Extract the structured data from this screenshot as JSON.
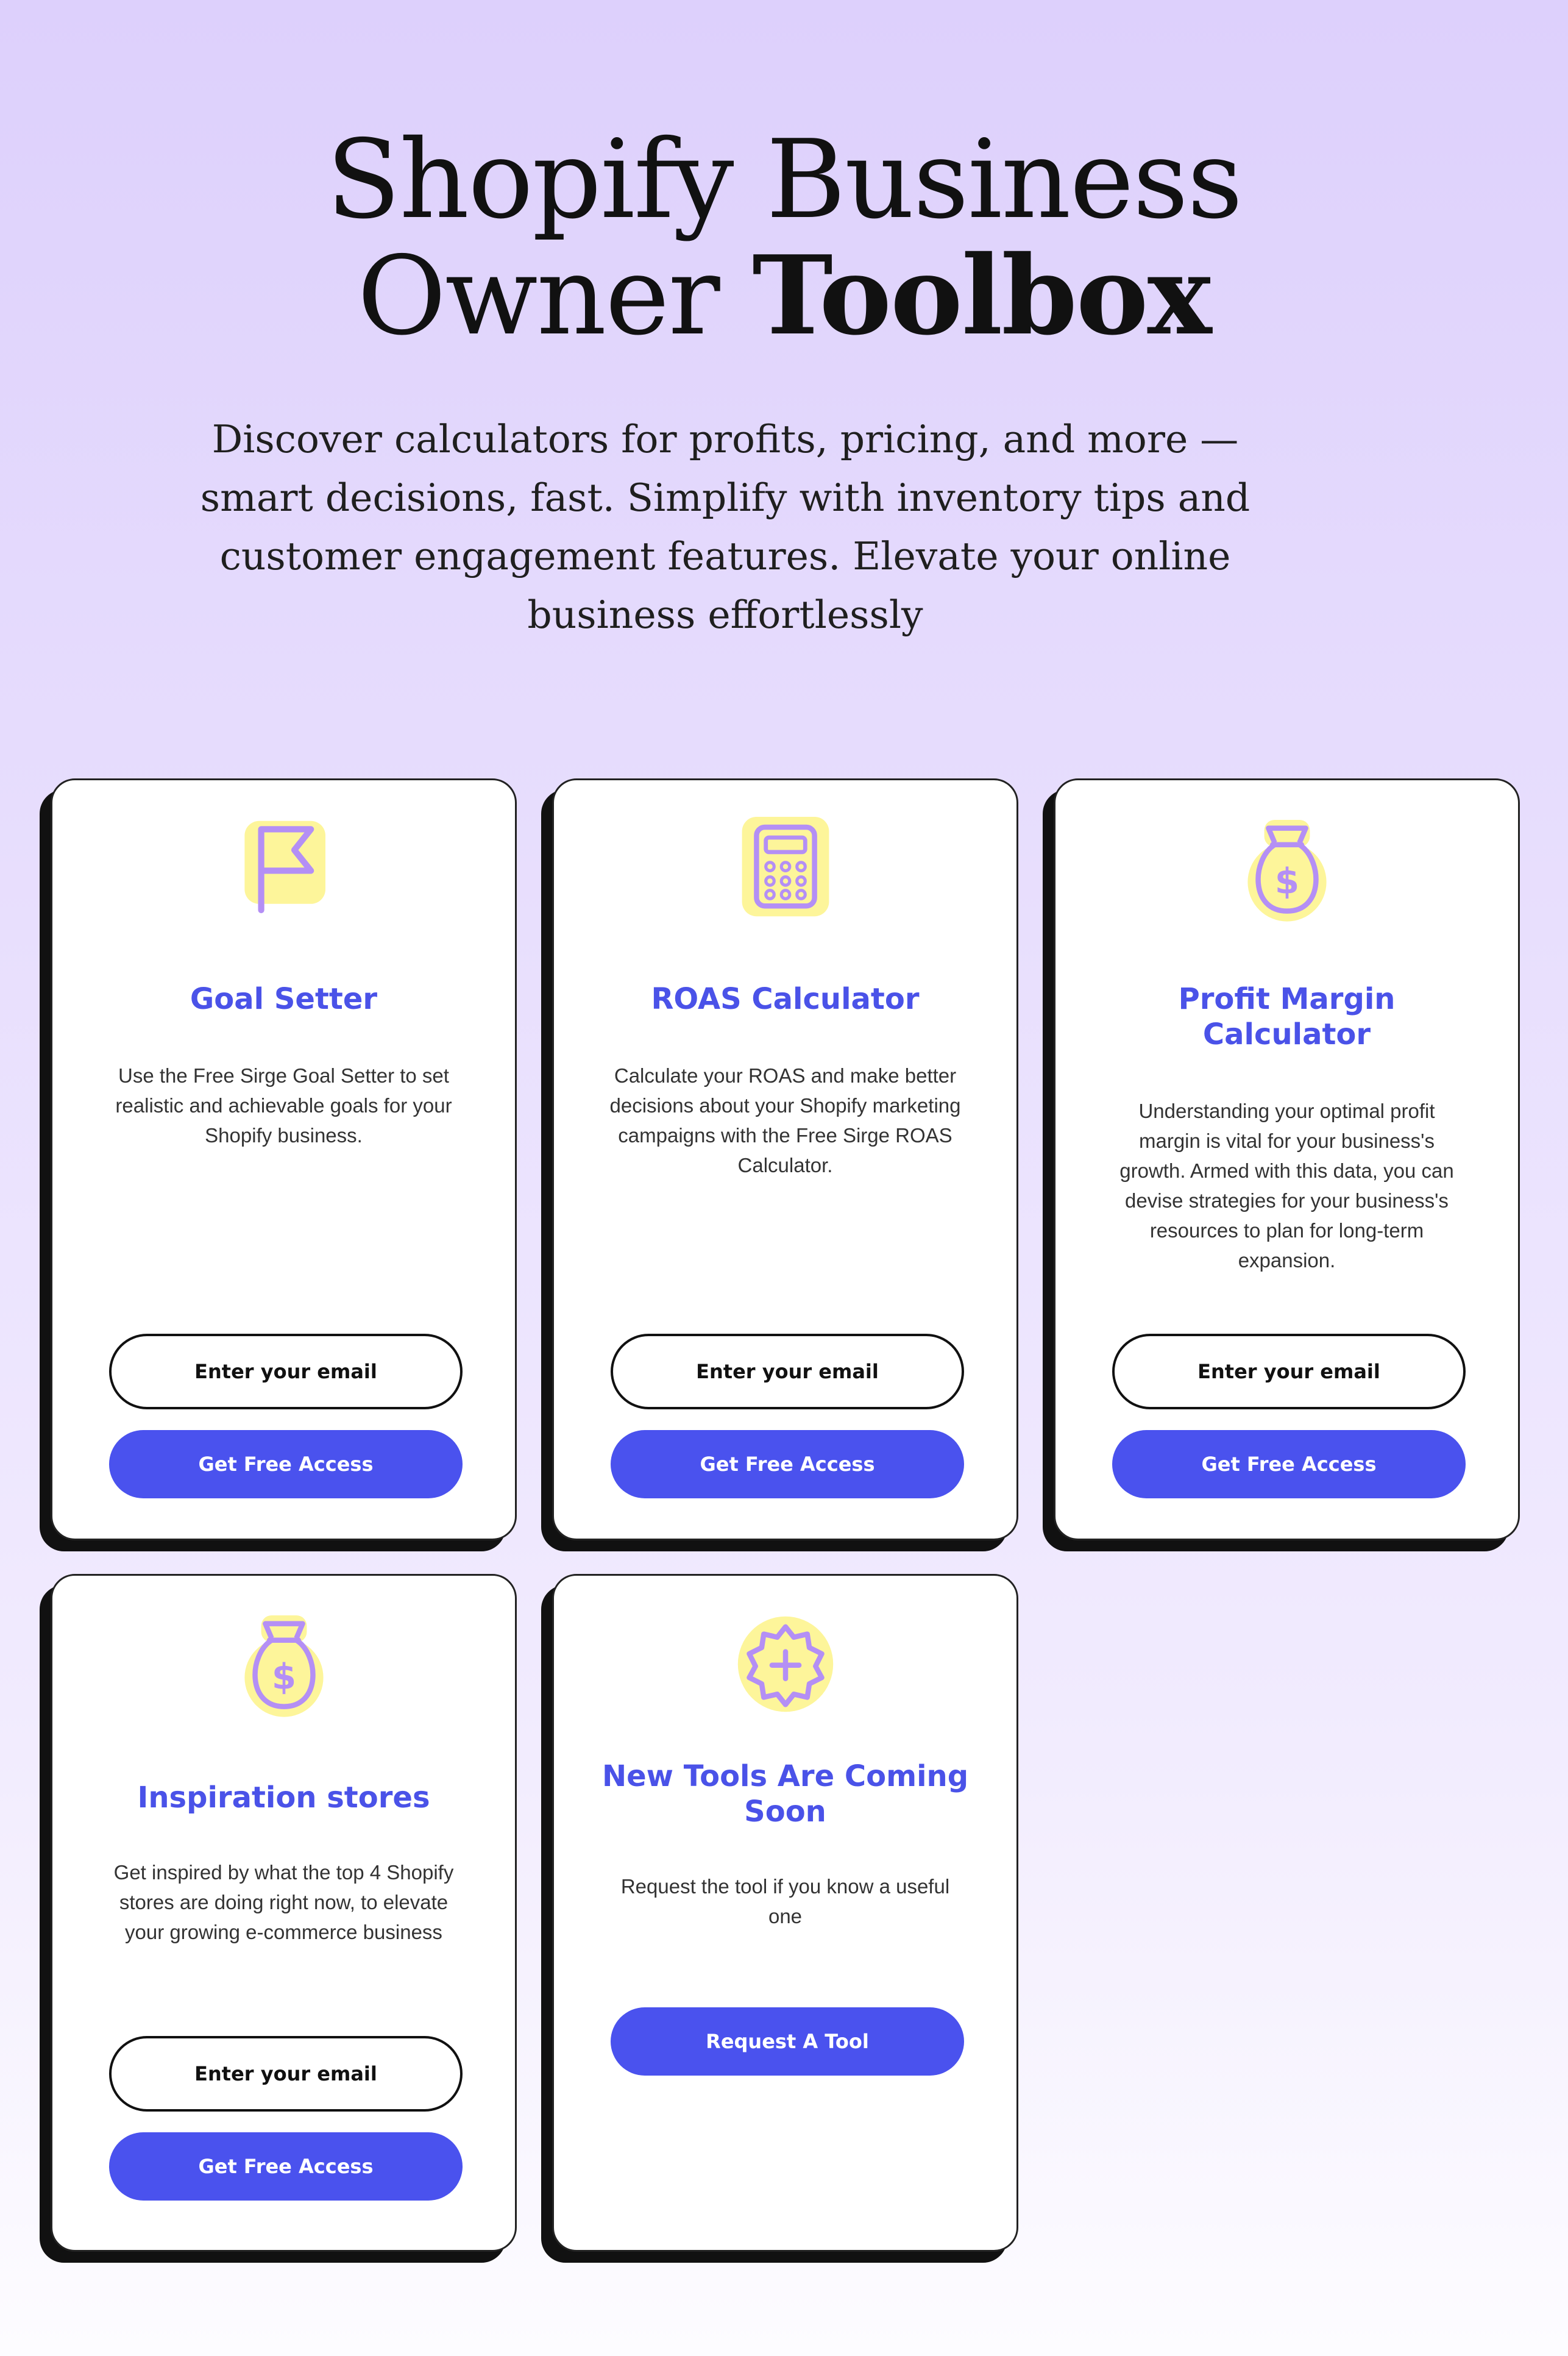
{
  "hero": {
    "title_line1": "Shopify Business",
    "title_line2_regular": "Owner",
    "title_line2_bold": "Toolbox",
    "subtitle": "Discover calculators for profits, pricing, and more — smart decisions, fast. Simplify with inventory tips and customer engagement features. Elevate your online business effortlessly"
  },
  "colors": {
    "accent": "#4a52ee",
    "icon_highlight": "#fdf59a",
    "icon_stroke": "#b48ff5",
    "card_shadow": "#111111"
  },
  "cards": [
    {
      "icon": "flag-icon",
      "title": "Goal Setter",
      "description": "Use the Free Sirge Goal Setter to set realistic and achievable goals for your Shopify business.",
      "email_placeholder": "Enter your email",
      "button_label": "Get Free Access"
    },
    {
      "icon": "calculator-icon",
      "title": "ROAS Calculator",
      "description": "Calculate your ROAS and make better decisions about your Shopify marketing campaigns with the Free Sirge ROAS Calculator.",
      "email_placeholder": "Enter your email",
      "button_label": "Get Free Access"
    },
    {
      "icon": "money-bag-icon",
      "title": "Profit Margin Calculator",
      "description": "Understanding your optimal profit margin is vital for your business's growth. Armed with this data, you can devise strategies for your business's resources to plan for long-term expansion.",
      "email_placeholder": "Enter your email",
      "button_label": "Get Free Access"
    },
    {
      "icon": "money-bag-icon",
      "title": "Inspiration stores",
      "description": "Get inspired by what the top 4 Shopify stores are doing right now, to elevate your growing  e-commerce business",
      "email_placeholder": "Enter your email",
      "button_label": "Get Free Access"
    },
    {
      "icon": "plus-badge-icon",
      "title": "New  Tools Are Coming Soon",
      "description": "Request the tool if you know a useful one",
      "button_label": "Request A Tool"
    }
  ]
}
